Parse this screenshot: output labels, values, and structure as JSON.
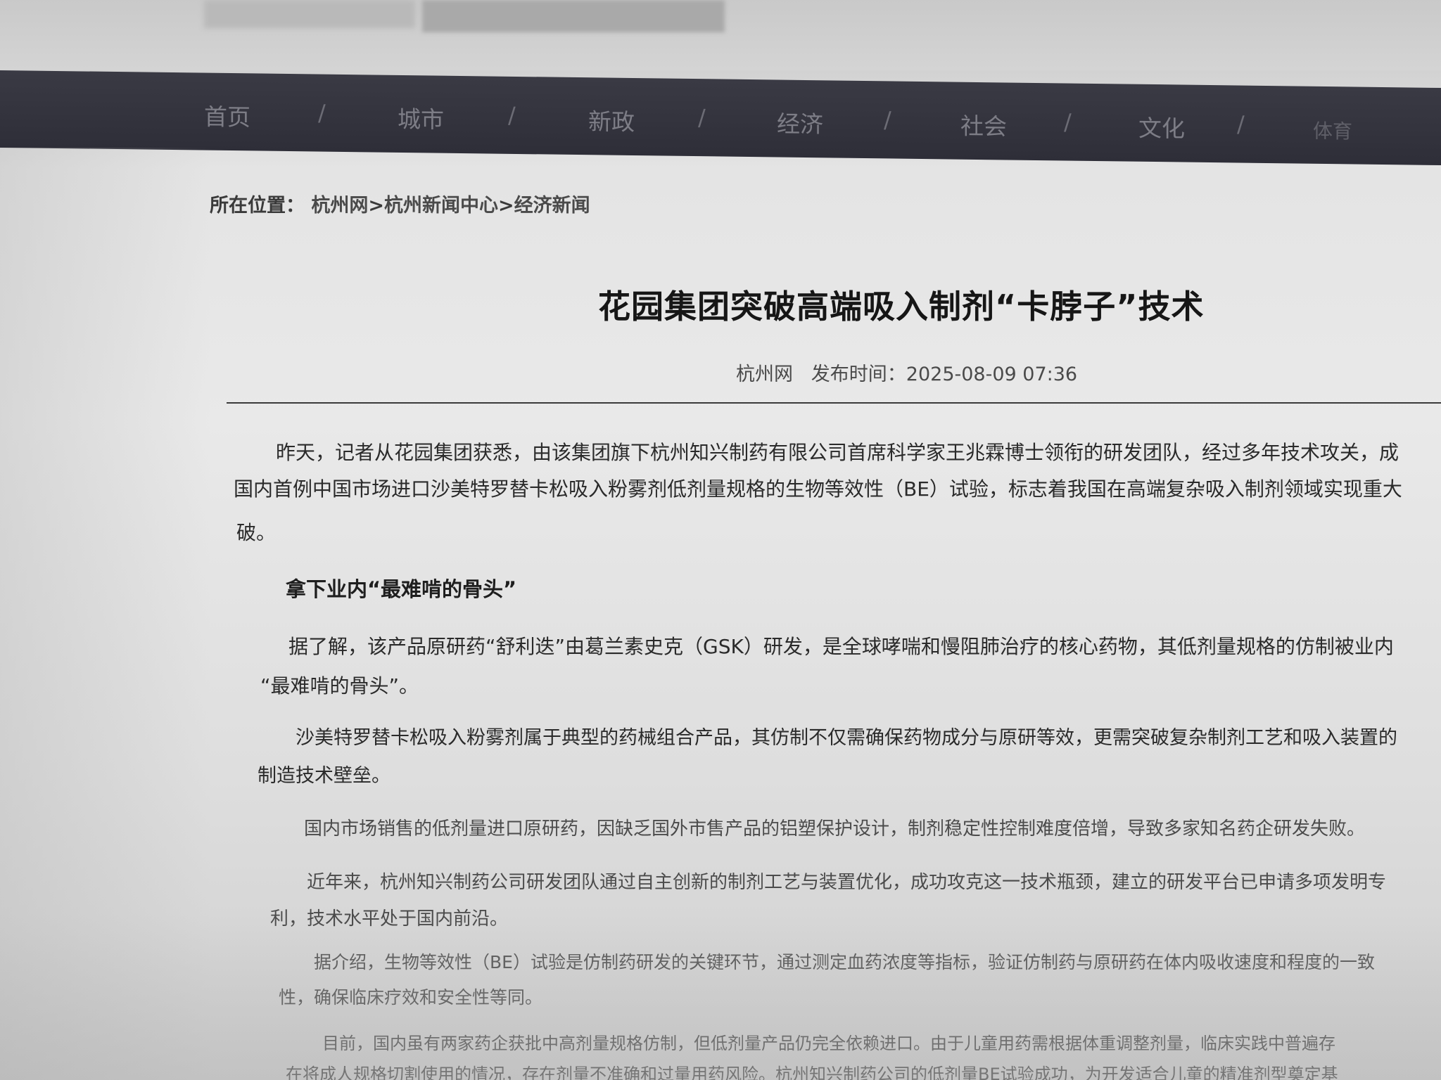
{
  "nav": {
    "items": [
      "首页",
      "城市",
      "新政",
      "经济",
      "社会",
      "文化",
      "体育"
    ],
    "separator": "/"
  },
  "breadcrumb": {
    "label": "所在位置：",
    "items": [
      "杭州网",
      "杭州新闻中心",
      "经济新闻"
    ],
    "separator": ">"
  },
  "article": {
    "title": "花园集团突破高端吸入制剂“卡脖子”技术",
    "source": "杭州网",
    "publish_label": "发布时间：",
    "publish_time": "2025-08-09 07:36",
    "lines": [
      "昨天，记者从花园集团获悉，由该集团旗下杭州知兴制药有限公司首席科学家王兆霖博士领衔的研发团队，经过多年技术攻关，成",
      "国内首例中国市场进口沙美特罗替卡松吸入粉雾剂低剂量规格的生物等效性（BE）试验，标志着我国在高端复杂吸入制剂领域实现重大",
      "破。",
      "拿下业内“最难啃的骨头”",
      "据了解，该产品原研药“舒利迭”由葛兰素史克（GSK）研发，是全球哮喘和慢阻肺治疗的核心药物，其低剂量规格的仿制被业内",
      "“最难啃的骨头”。",
      "沙美特罗替卡松吸入粉雾剂属于典型的药械组合产品，其仿制不仅需确保药物成分与原研等效，更需突破复杂制剂工艺和吸入装置的",
      "制造技术壁垒。",
      "国内市场销售的低剂量进口原研药，因缺乏国外市售产品的铝塑保护设计，制剂稳定性控制难度倍增，导致多家知名药企研发失败。",
      "近年来，杭州知兴制药公司研发团队通过自主创新的制剂工艺与装置优化，成功攻克这一技术瓶颈，建立的研发平台已申请多项发明专",
      "利，技术水平处于国内前沿。",
      "据介绍，生物等效性（BE）试验是仿制药研发的关键环节，通过测定血药浓度等指标，验证仿制药与原研药在体内吸收速度和程度的一致",
      "性，确保临床疗效和安全性等同。",
      "目前，国内虽有两家药企获批中高剂量规格仿制，但低剂量产品仍完全依赖进口。由于儿童用药需根据体重调整剂量，临床实践中普遍存",
      "在将成人规格切割使用的情况，存在剂量不准确和过量用药风险。杭州知兴制药公司的低剂量BE试验成功，为开发适合儿童的精准剂型奠定基"
    ]
  }
}
